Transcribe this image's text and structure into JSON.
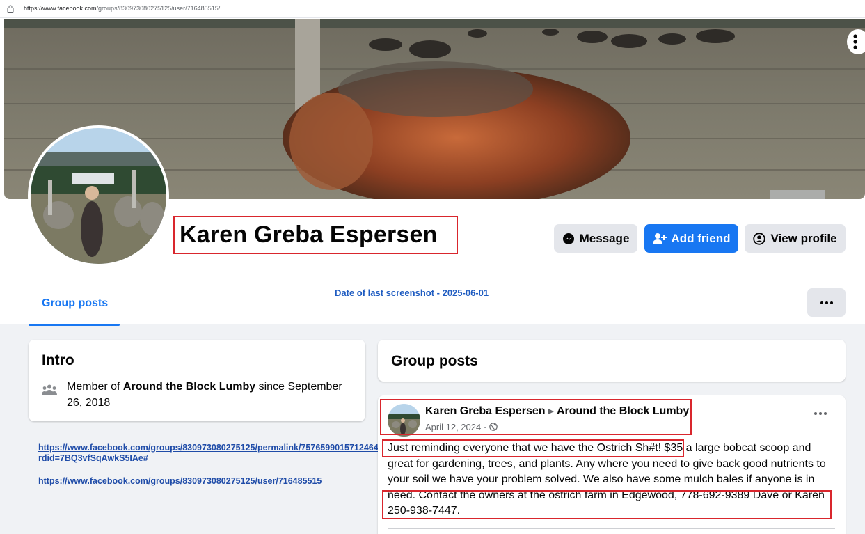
{
  "browser": {
    "url_host": "https://www.facebook.com",
    "url_path": "/groups/830973080275125/user/716485515/"
  },
  "profile": {
    "name": "Karen Greba Espersen"
  },
  "actions": {
    "message_label": "Message",
    "add_friend_label": "Add friend",
    "view_profile_label": "View profile"
  },
  "tabs": {
    "group_posts_label": "Group posts"
  },
  "annotation": {
    "screenshot_date": "Date of last screenshot - 2025-06-01"
  },
  "intro": {
    "title": "Intro",
    "member_prefix": "Member of ",
    "group_name": "Around the Block Lumby",
    "member_suffix": " since September 26, 2018"
  },
  "links": [
    "https://www.facebook.com/groups/830973080275125/permalink/7576599015712464/?rdid=7BQ3vfSqAwkS5IAe#",
    "https://www.facebook.com/groups/830973080275125/user/716485515"
  ],
  "group_posts": {
    "title": "Group posts"
  },
  "post": {
    "author": "Karen Greba Espersen",
    "group": "Around the Block Lumby",
    "date": "April 12, 2024 ·",
    "body": "Just reminding everyone that we have the  Ostrich Sh#t!  $35 a large bobcat scoop and great for gardening, trees, and plants.  Any where you need to give back good nutrients to your soil we have your problem solved.  We also have some mulch bales if anyone is in need.  Contact the owners at the ostrich farm in Edgewood, 778-692-9389 Dave or Karen 250-938-7447."
  },
  "colors": {
    "accent": "#1877f2",
    "highlight_box": "#d9262d",
    "page_bg": "#f0f2f5"
  },
  "icons": [
    "lock-icon",
    "vertical-dots-icon",
    "messenger-icon",
    "add-person-icon",
    "profile-circle-icon",
    "more-dots-icon",
    "group-members-icon",
    "globe-icon"
  ]
}
